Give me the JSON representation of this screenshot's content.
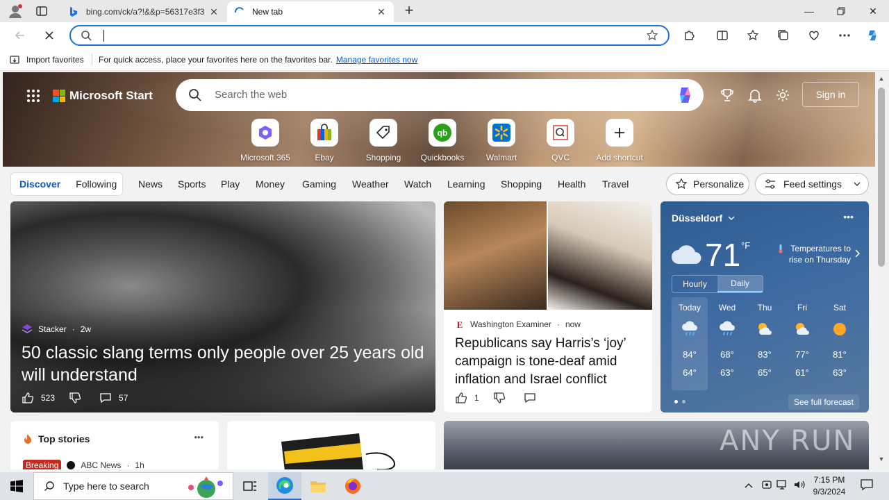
{
  "browser": {
    "tabs": [
      {
        "title": "bing.com/ck/a?!&&p=56317e3f3"
      },
      {
        "title": "New tab"
      }
    ],
    "address_value": "",
    "favorites_bar": {
      "import_label": "Import favorites",
      "message": "For quick access, place your favorites here on the favorites bar.",
      "link": "Manage favorites now"
    }
  },
  "header": {
    "brand": "Microsoft Start",
    "search_placeholder": "Search the web",
    "sign_in": "Sign in"
  },
  "shortcuts": [
    {
      "label": "Microsoft 365"
    },
    {
      "label": "Ebay"
    },
    {
      "label": "Shopping"
    },
    {
      "label": "Quickbooks"
    },
    {
      "label": "Walmart"
    },
    {
      "label": "QVC"
    },
    {
      "label": "Add shortcut"
    }
  ],
  "feed_nav": {
    "discover": "Discover",
    "following": "Following",
    "categories": [
      "News",
      "Sports",
      "Play",
      "Money",
      "Gaming",
      "Weather",
      "Watch",
      "Learning",
      "Shopping",
      "Health",
      "Travel"
    ],
    "personalize": "Personalize",
    "feed_settings": "Feed settings"
  },
  "hero_story": {
    "source": "Stacker",
    "age": "2w",
    "title": "50 classic slang terms only people over 25 years old will understand",
    "likes": "523",
    "comments": "57"
  },
  "side_story": {
    "source": "Washington Examiner",
    "age": "now",
    "title": "Republicans say Harris’s ‘joy’ campaign is tone-deaf amid inflation and Israel conflict",
    "likes": "1"
  },
  "weather": {
    "city": "Düsseldorf",
    "temp": "71",
    "unit": "°F",
    "note": "Temperatures to rise on Thursday",
    "tabs": [
      "Hourly",
      "Daily"
    ],
    "days": [
      {
        "name": "Today",
        "hi": "84°",
        "lo": "64°",
        "icon": "rain-cloud-icon"
      },
      {
        "name": "Wed",
        "hi": "68°",
        "lo": "63°",
        "icon": "rain-cloud-icon"
      },
      {
        "name": "Thu",
        "hi": "83°",
        "lo": "65°",
        "icon": "partly-sunny-icon"
      },
      {
        "name": "Fri",
        "hi": "77°",
        "lo": "61°",
        "icon": "partly-sunny-icon"
      },
      {
        "name": "Sat",
        "hi": "81°",
        "lo": "63°",
        "icon": "sun-icon"
      }
    ],
    "see_full": "See full forecast"
  },
  "top_stories": {
    "heading": "Top stories",
    "badge": "Breaking",
    "source": "ABC News",
    "age": "1h"
  },
  "watermark": "ANY RUN",
  "taskbar": {
    "search_placeholder": "Type here to search",
    "time": "7:15 PM",
    "date": "9/3/2024"
  }
}
